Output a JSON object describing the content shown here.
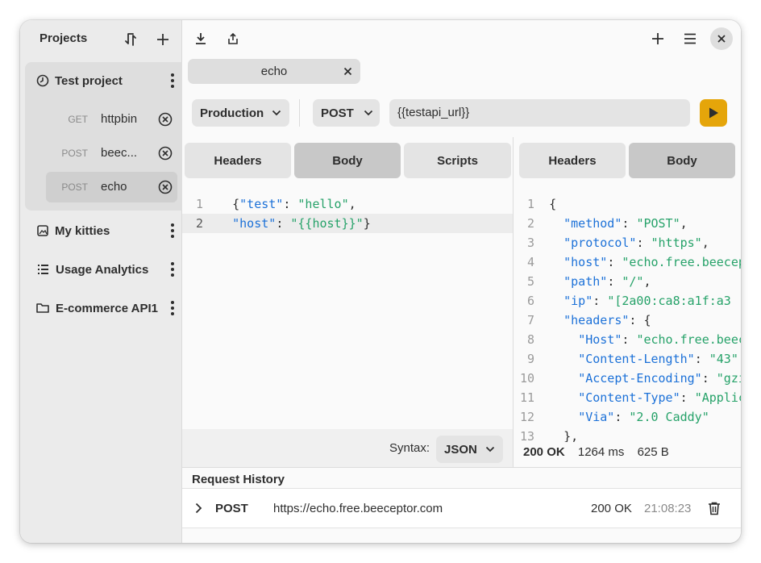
{
  "sidebar": {
    "title": "Projects",
    "projects": [
      {
        "name": "Test project",
        "icon": "clock-icon",
        "requests": [
          {
            "method": "GET",
            "name": "httpbin"
          },
          {
            "method": "POST",
            "name": "beec..."
          },
          {
            "method": "POST",
            "name": "echo"
          }
        ]
      },
      {
        "name": "My kitties",
        "icon": "image-icon"
      },
      {
        "name": "Usage Analytics",
        "icon": "list-icon"
      },
      {
        "name": "E-commerce API1",
        "icon": "folder-icon"
      }
    ]
  },
  "tabs": [
    {
      "label": "echo"
    }
  ],
  "request": {
    "environment": "Production",
    "method": "POST",
    "url": "{{testapi_url}}"
  },
  "left_pane": {
    "tabs": [
      "Headers",
      "Body",
      "Scripts"
    ],
    "active": "Body",
    "line_numbers": [
      "1",
      "2"
    ],
    "syntax_label": "Syntax:",
    "syntax_value": "JSON"
  },
  "right_pane": {
    "tabs": [
      "Headers",
      "Body"
    ],
    "active": "Body",
    "line_numbers": [
      "1",
      "2",
      "3",
      "4",
      "5",
      "6",
      "7",
      "8",
      "9",
      "10",
      "11",
      "12",
      "13"
    ],
    "status": "200 OK",
    "time": "1264 ms",
    "size": "625 B"
  },
  "history": {
    "title": "Request History",
    "rows": [
      {
        "method": "POST",
        "url": "https://echo.free.beeceptor.com",
        "status": "200 OK",
        "time": "21:08:23"
      }
    ]
  },
  "colors": {
    "accent": "#e5a50a",
    "key": "#1c71d8",
    "string": "#26a269"
  }
}
